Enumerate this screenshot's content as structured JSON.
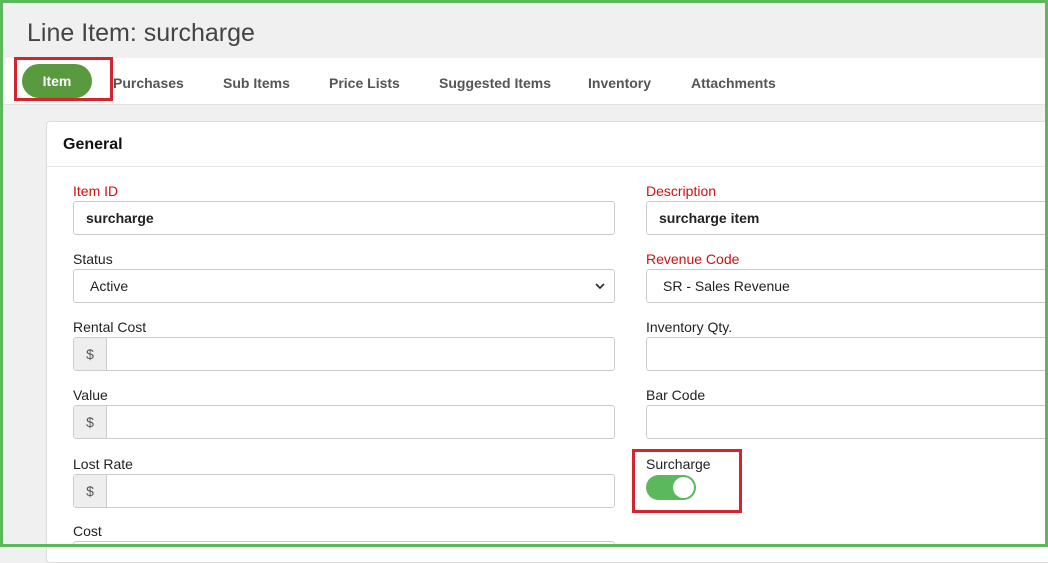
{
  "page": {
    "title": "Line Item: surcharge"
  },
  "tabs": [
    {
      "label": "Item"
    },
    {
      "label": "Purchases"
    },
    {
      "label": "Sub Items"
    },
    {
      "label": "Price Lists"
    },
    {
      "label": "Suggested Items"
    },
    {
      "label": "Inventory"
    },
    {
      "label": "Attachments"
    }
  ],
  "general": {
    "title": "General",
    "item_id": {
      "label": "Item ID",
      "value": "surcharge"
    },
    "description": {
      "label": "Description",
      "value": "surcharge item"
    },
    "status": {
      "label": "Status",
      "value": "Active"
    },
    "revenue_code": {
      "label": "Revenue Code",
      "value": "SR - Sales Revenue"
    },
    "rental_cost": {
      "label": "Rental Cost",
      "prefix": "$",
      "value": ""
    },
    "inventory_qty": {
      "label": "Inventory Qty.",
      "value": ""
    },
    "value_field": {
      "label": "Value",
      "prefix": "$",
      "value": ""
    },
    "bar_code": {
      "label": "Bar Code",
      "value": ""
    },
    "lost_rate": {
      "label": "Lost Rate",
      "prefix": "$",
      "value": ""
    },
    "surcharge": {
      "label": "Surcharge",
      "enabled": true
    },
    "cost": {
      "label": "Cost"
    }
  },
  "colors": {
    "accent": "#5a9a3f",
    "highlight": "#d3252b",
    "frame": "#5cb85c",
    "required": "#cc1111"
  }
}
